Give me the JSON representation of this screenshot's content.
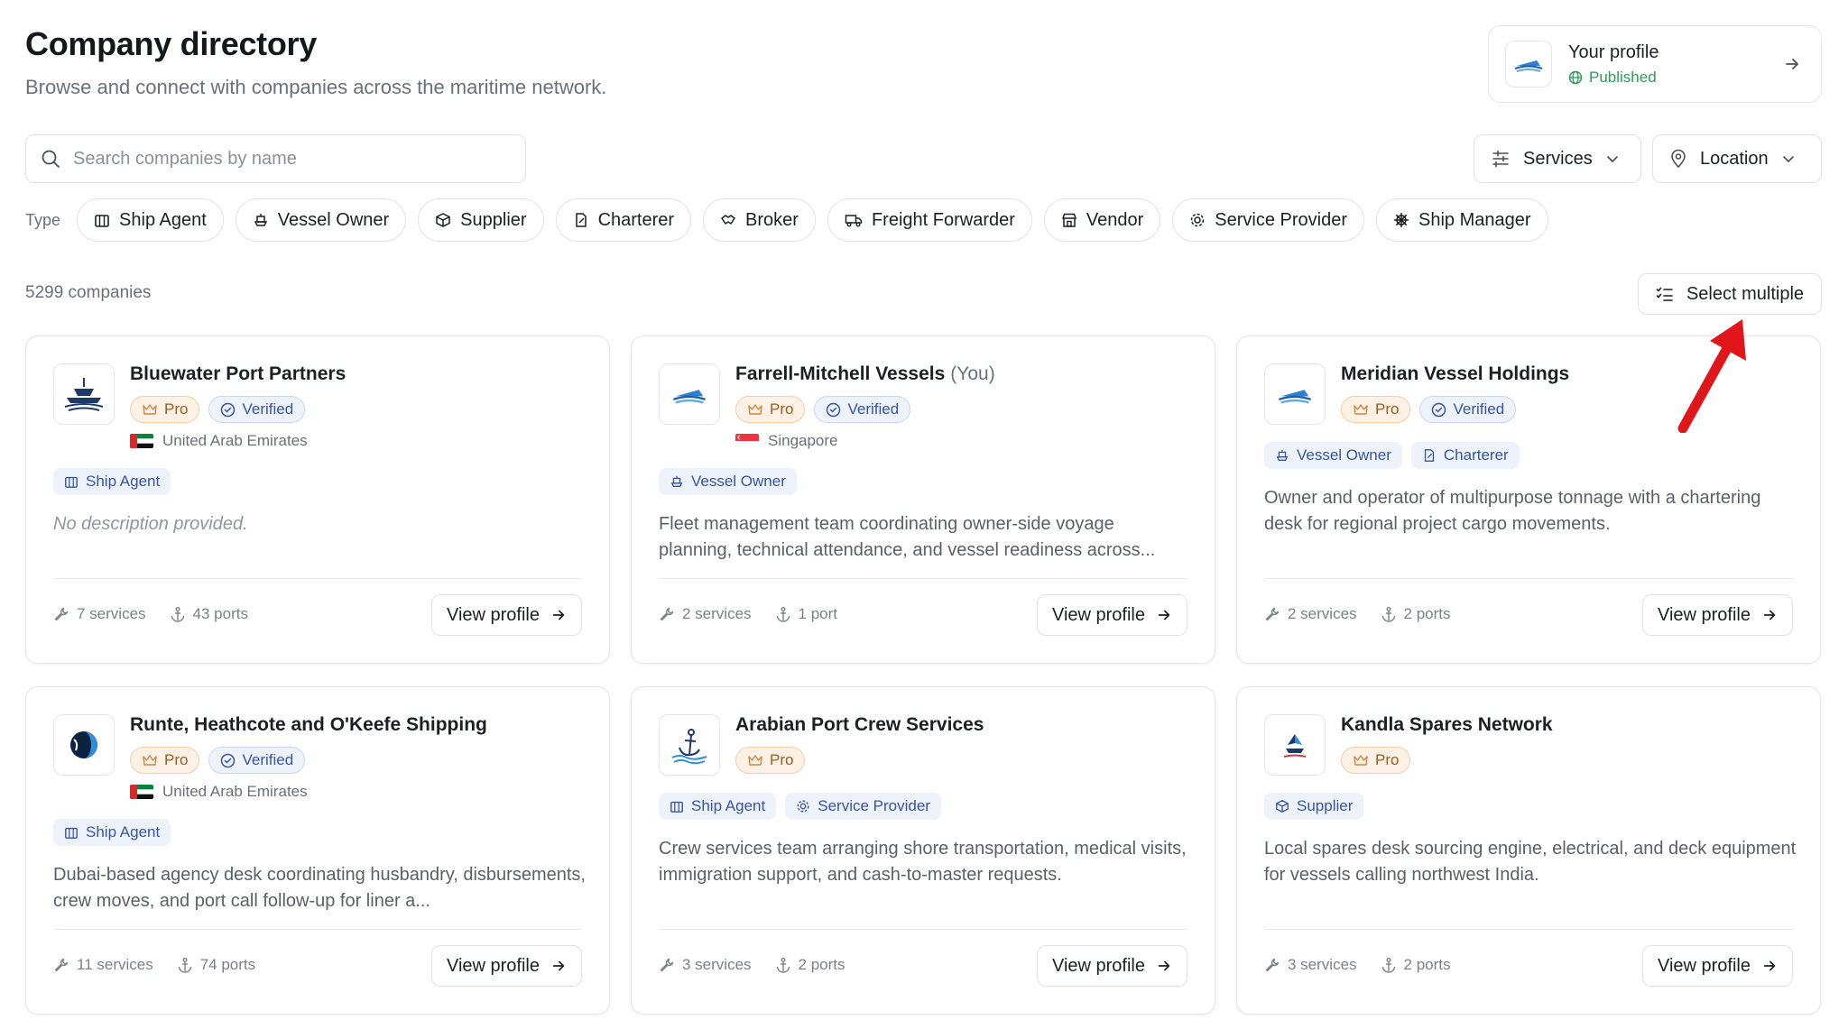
{
  "header": {
    "title": "Company directory",
    "subtitle": "Browse and connect with companies across the maritime network."
  },
  "profile": {
    "label": "Your profile",
    "status": "Published"
  },
  "search": {
    "placeholder": "Search companies by name",
    "value": ""
  },
  "filters": {
    "services": "Services",
    "location": "Location"
  },
  "type_filter": {
    "label": "Type",
    "chips": [
      {
        "label": "Ship Agent",
        "icon": "building-icon"
      },
      {
        "label": "Vessel Owner",
        "icon": "ship-icon"
      },
      {
        "label": "Supplier",
        "icon": "box-icon"
      },
      {
        "label": "Charterer",
        "icon": "document-icon"
      },
      {
        "label": "Broker",
        "icon": "handshake-icon"
      },
      {
        "label": "Freight Forwarder",
        "icon": "truck-icon"
      },
      {
        "label": "Vendor",
        "icon": "store-icon"
      },
      {
        "label": "Service Provider",
        "icon": "gear-icon"
      },
      {
        "label": "Ship Manager",
        "icon": "helm-icon"
      }
    ]
  },
  "results": {
    "count": "5299 companies",
    "select_multiple": "Select multiple"
  },
  "cards": [
    {
      "name": "Bluewater Port Partners",
      "you": "",
      "pro": "Pro",
      "verified": "Verified",
      "country": "United Arab Emirates",
      "types": [
        "Ship Agent"
      ],
      "description": "No description provided.",
      "services": "7 services",
      "ports": "43 ports",
      "action": "View profile"
    },
    {
      "name": "Farrell-Mitchell Vessels",
      "you": "(You)",
      "pro": "Pro",
      "verified": "Verified",
      "country": "Singapore",
      "types": [
        "Vessel Owner"
      ],
      "description": "Fleet management team coordinating owner-side voyage planning, technical attendance, and vessel readiness across...",
      "services": "2 services",
      "ports": "1 port",
      "action": "View profile"
    },
    {
      "name": "Meridian Vessel Holdings",
      "you": "",
      "pro": "Pro",
      "verified": "Verified",
      "country": "",
      "types": [
        "Vessel Owner",
        "Charterer"
      ],
      "description": "Owner and operator of multipurpose tonnage with a chartering desk for regional project cargo movements.",
      "services": "2 services",
      "ports": "2 ports",
      "action": "View profile"
    },
    {
      "name": "Runte, Heathcote and O'Keefe Shipping",
      "you": "",
      "pro": "Pro",
      "verified": "Verified",
      "country": "United Arab Emirates",
      "types": [
        "Ship Agent"
      ],
      "description": "Dubai-based agency desk coordinating husbandry, disbursements, crew moves, and port call follow-up for liner a...",
      "services": "11 services",
      "ports": "74 ports",
      "action": "View profile"
    },
    {
      "name": "Arabian Port Crew Services",
      "you": "",
      "pro": "Pro",
      "verified": "",
      "country": "",
      "types": [
        "Ship Agent",
        "Service Provider"
      ],
      "description": "Crew services team arranging shore transportation, medical visits, immigration support, and cash-to-master requests.",
      "services": "3 services",
      "ports": "2 ports",
      "action": "View profile"
    },
    {
      "name": "Kandla Spares Network",
      "you": "",
      "pro": "Pro",
      "verified": "",
      "country": "",
      "types": [
        "Supplier"
      ],
      "description": "Local spares desk sourcing engine, electrical, and deck equipment for vessels calling northwest India.",
      "services": "3 services",
      "ports": "2 ports",
      "action": "View profile"
    }
  ],
  "colors": {
    "accent": "#3656a4",
    "pro": "#9c5d24",
    "published": "#2e9a5a",
    "annotation": "#e0161b"
  }
}
